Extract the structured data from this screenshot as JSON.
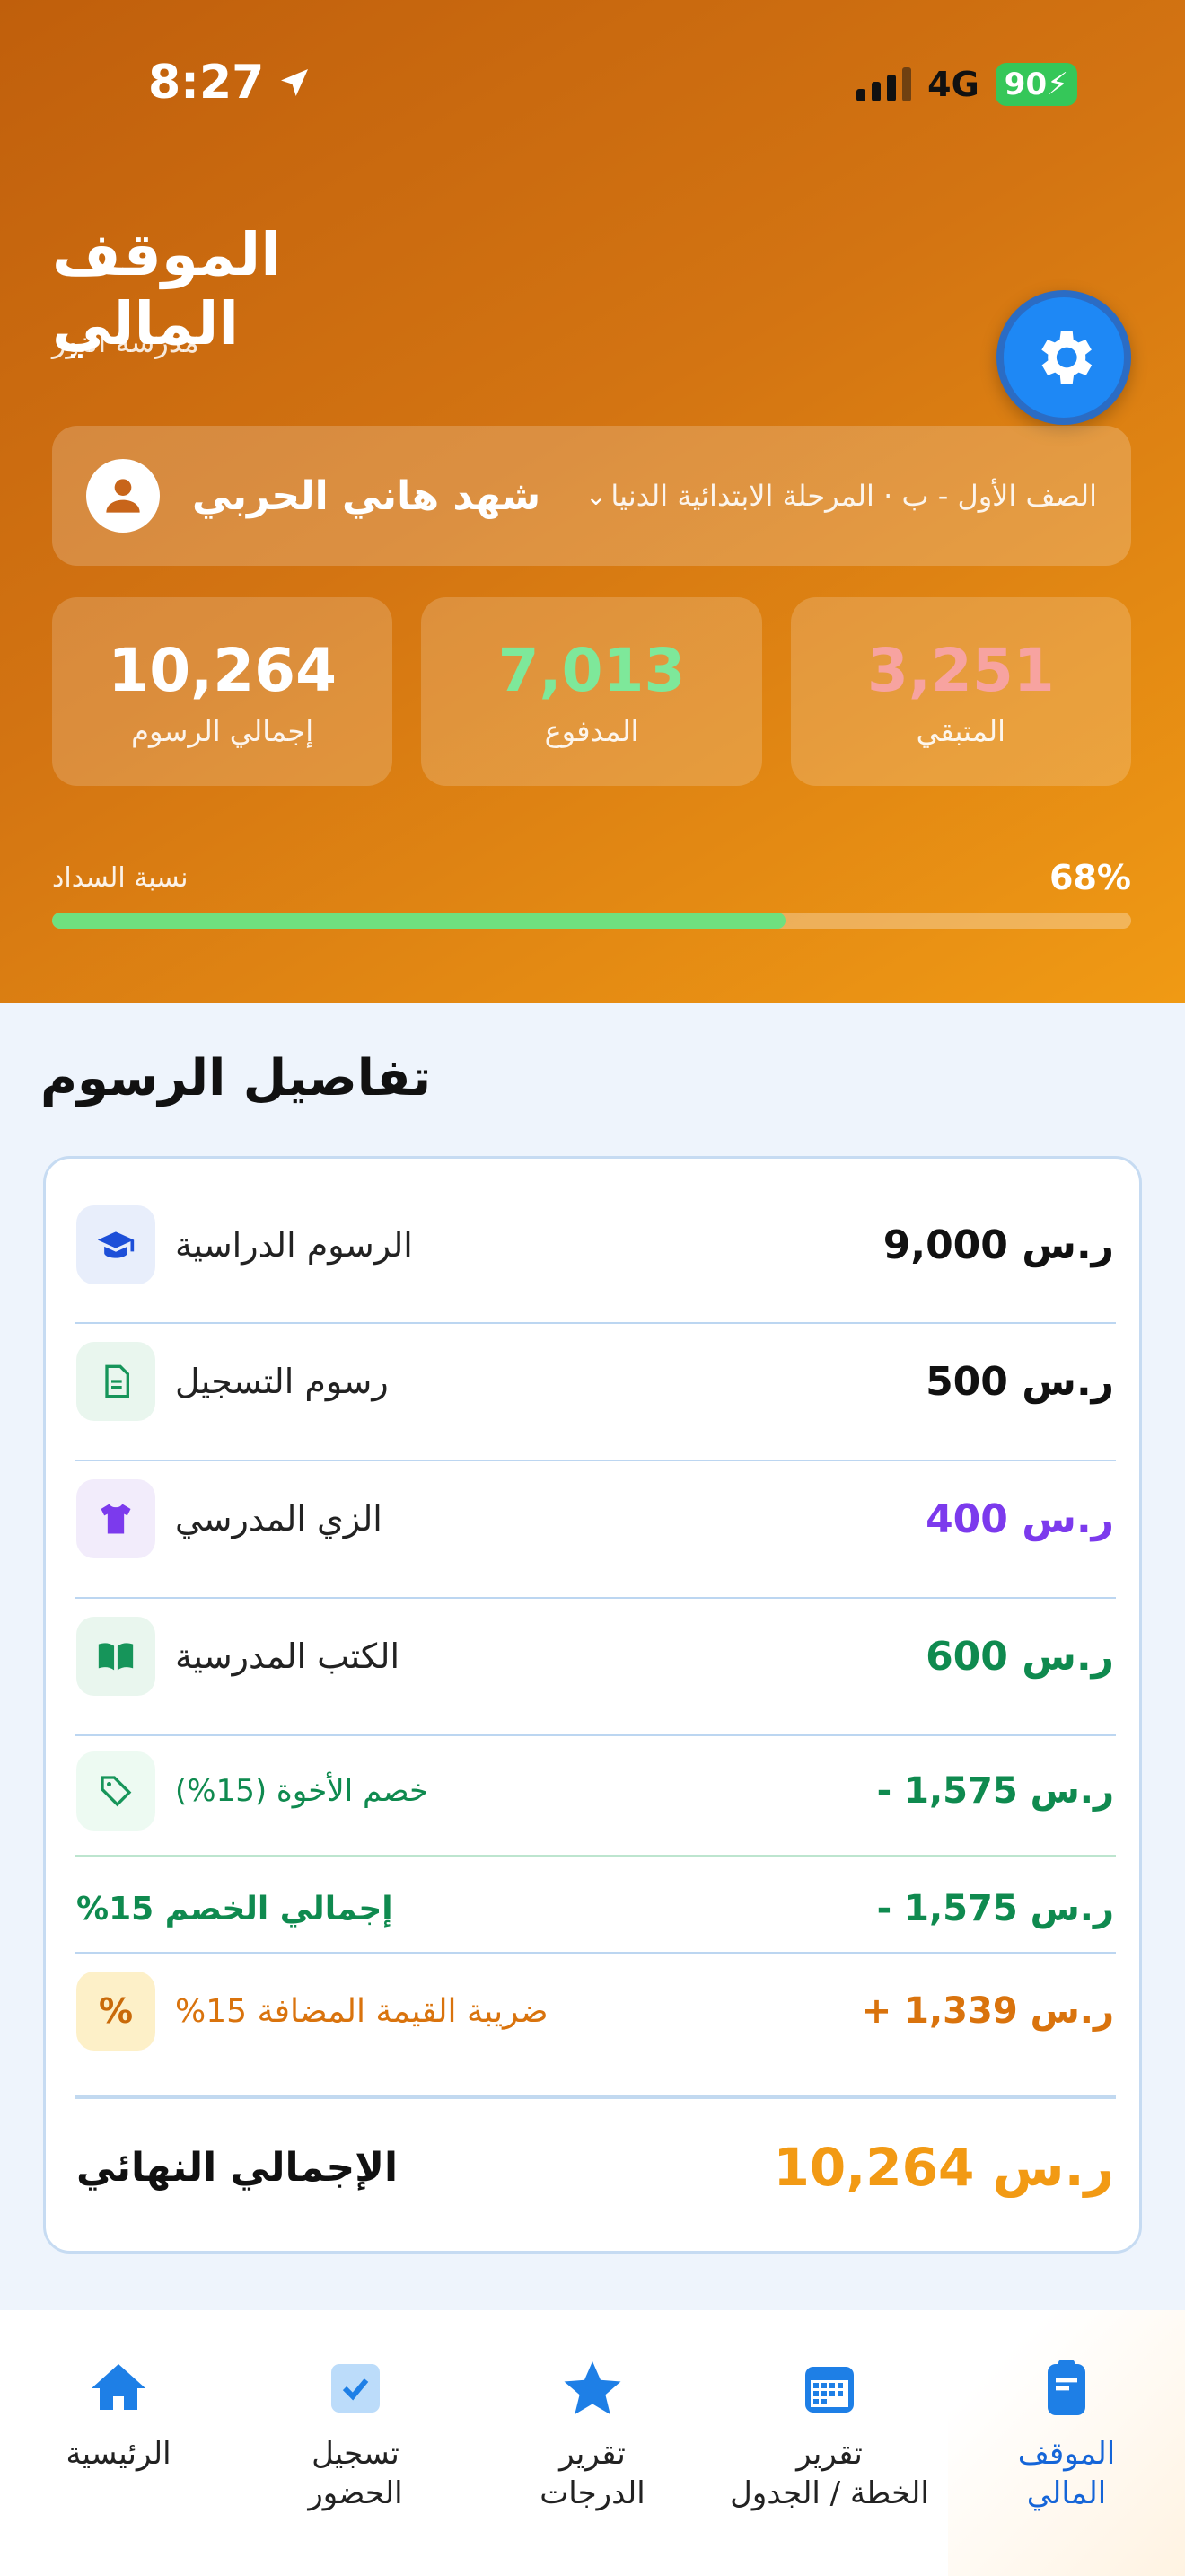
{
  "status_bar": {
    "time": "8:27",
    "network": "4G",
    "battery": "90"
  },
  "header": {
    "title": "الموقف المالي",
    "school": "مدرسة النور",
    "student_name": "شهد هاني الحربي",
    "student_class": "الصف الأول - ب · المرحلة الابتدائية الدنيا"
  },
  "stats": {
    "total": {
      "value": "10,264",
      "label": "إجمالي الرسوم",
      "color": "#ffffff"
    },
    "paid": {
      "value": "7,013",
      "label": "المدفوع",
      "color": "#7ee89a"
    },
    "remaining": {
      "value": "3,251",
      "label": "المتبقي",
      "color": "#f7a3a0"
    }
  },
  "progress": {
    "label": "نسبة السداد",
    "percent_text": "68%",
    "percent": 68
  },
  "fees": {
    "section_title": "تفاصيل الرسوم",
    "items": [
      {
        "label": "الرسوم الدراسية",
        "amount": "9,000 ر.س",
        "icon": "graduation-cap-icon",
        "amount_color": "#111111",
        "icon_bg": "#e8eefb"
      },
      {
        "label": "رسوم التسجيل",
        "amount": "500 ر.س",
        "icon": "document-icon",
        "amount_color": "#111111",
        "icon_bg": "#e9f6ee"
      },
      {
        "label": "الزي المدرسي",
        "amount": "400 ر.س",
        "icon": "shirt-icon",
        "amount_color": "#7c3aed",
        "icon_bg": "#f2ecfb"
      },
      {
        "label": "الكتب المدرسية",
        "amount": "600 ر.س",
        "icon": "book-icon",
        "amount_color": "#0f8a4f",
        "icon_bg": "#e9f6ee"
      }
    ],
    "sibling_discount": {
      "label": "خصم الأخوة (15%)",
      "amount": "- 1,575 ر.س",
      "color": "#0f8a4f"
    },
    "total_discount": {
      "label": "إجمالي الخصم 15%",
      "amount": "- 1,575 ر.س",
      "color": "#0f8a4f"
    },
    "vat": {
      "label": "ضريبة القيمة المضافة 15%",
      "amount": "+ 1,339 ر.س",
      "color": "#d9730d"
    },
    "final": {
      "label": "الإجمالي النهائي",
      "amount": "10,264 ر.س",
      "color": "#f29a14"
    }
  },
  "nav": [
    {
      "label": "الرئيسية",
      "icon": "home-icon"
    },
    {
      "label": "تسجيل\nالحضور",
      "icon": "checkbox-icon"
    },
    {
      "label": "تقرير\nالدرجات",
      "icon": "star-icon"
    },
    {
      "label": "تقرير\nالخطة / الجدول",
      "icon": "calendar-icon"
    },
    {
      "label": "الموقف\nالمالي",
      "icon": "clipboard-icon",
      "active": true
    }
  ]
}
